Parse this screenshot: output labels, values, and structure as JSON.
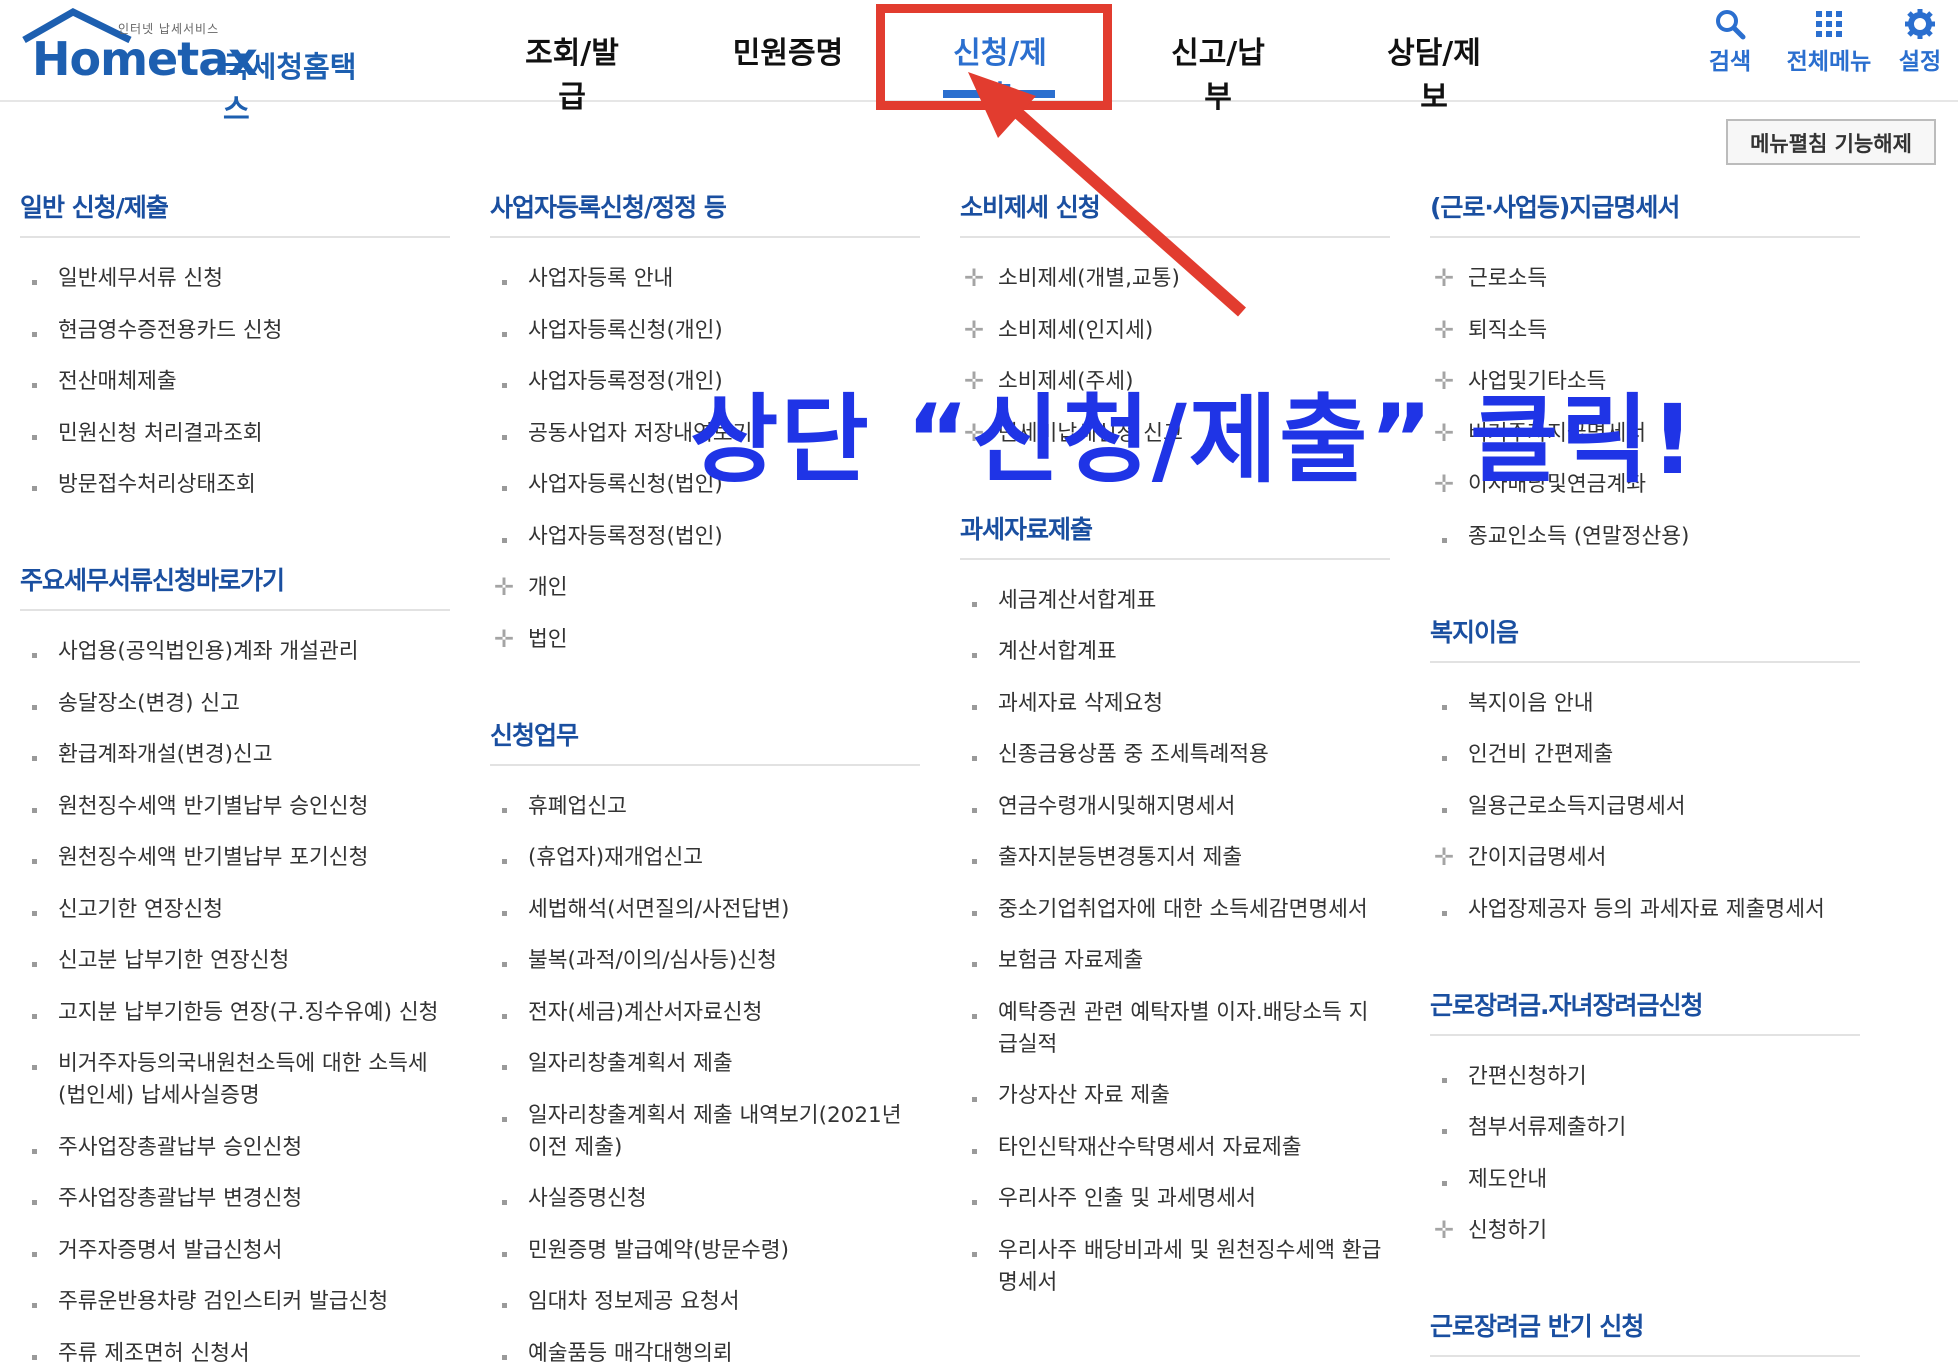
{
  "header": {
    "logo": {
      "small": "인터넷 납세서비스",
      "main": "Hometax",
      "sub": "국세청홈택스"
    },
    "nav": [
      {
        "label": "조회/발급"
      },
      {
        "label": "민원증명"
      },
      {
        "label": "신청/제출",
        "active": true
      },
      {
        "label": "신고/납부"
      },
      {
        "label": "상담/제보"
      }
    ],
    "utils": {
      "search": "검색",
      "all_menu": "전체메뉴",
      "settings": "설정"
    },
    "release_button": "메뉴펼침 기능해제"
  },
  "columns": [
    {
      "sections": [
        {
          "title": "일반 신청/제출",
          "items": [
            {
              "label": "일반세무서류 신청",
              "mark": "bullet"
            },
            {
              "label": "현금영수증전용카드 신청",
              "mark": "bullet"
            },
            {
              "label": "전산매체제출",
              "mark": "bullet"
            },
            {
              "label": "민원신청 처리결과조회",
              "mark": "bullet"
            },
            {
              "label": "방문접수처리상태조회",
              "mark": "bullet"
            }
          ]
        },
        {
          "title": "주요세무서류신청바로가기",
          "items": [
            {
              "label": "사업용(공익법인용)계좌 개설관리",
              "mark": "bullet"
            },
            {
              "label": "송달장소(변경) 신고",
              "mark": "bullet"
            },
            {
              "label": "환급계좌개설(변경)신고",
              "mark": "bullet"
            },
            {
              "label": "원천징수세액 반기별납부 승인신청",
              "mark": "bullet"
            },
            {
              "label": "원천징수세액 반기별납부 포기신청",
              "mark": "bullet"
            },
            {
              "label": "신고기한 연장신청",
              "mark": "bullet"
            },
            {
              "label": "신고분 납부기한 연장신청",
              "mark": "bullet"
            },
            {
              "label": "고지분 납부기한등 연장(구.징수유예) 신청",
              "mark": "bullet"
            },
            {
              "label": "비거주자등의국내원천소득에 대한 소득세(법인세) 납세사실증명",
              "mark": "bullet"
            },
            {
              "label": "주사업장총괄납부 승인신청",
              "mark": "bullet"
            },
            {
              "label": "주사업장총괄납부 변경신청",
              "mark": "bullet"
            },
            {
              "label": "거주자증명서 발급신청서",
              "mark": "bullet"
            },
            {
              "label": "주류운반용차량 검인스티커 발급신청",
              "mark": "bullet"
            },
            {
              "label": "주류 제조면허 신청서",
              "mark": "bullet"
            }
          ]
        }
      ]
    },
    {
      "sections": [
        {
          "title": "사업자등록신청/정정 등",
          "items": [
            {
              "label": "사업자등록 안내",
              "mark": "bullet"
            },
            {
              "label": "사업자등록신청(개인)",
              "mark": "bullet"
            },
            {
              "label": "사업자등록정정(개인)",
              "mark": "bullet"
            },
            {
              "label": "공동사업자 저장내역보기",
              "mark": "bullet"
            },
            {
              "label": "사업자등록신청(법인)",
              "mark": "bullet"
            },
            {
              "label": "사업자등록정정(법인)",
              "mark": "bullet"
            },
            {
              "label": "개인",
              "mark": "plus"
            },
            {
              "label": "법인",
              "mark": "plus"
            }
          ]
        },
        {
          "title": "신청업무",
          "items": [
            {
              "label": "휴폐업신고",
              "mark": "bullet"
            },
            {
              "label": "(휴업자)재개업신고",
              "mark": "bullet"
            },
            {
              "label": "세법해석(서면질의/사전답변)",
              "mark": "bullet"
            },
            {
              "label": "불복(과적/이의/심사등)신청",
              "mark": "bullet"
            },
            {
              "label": "전자(세금)계산서자료신청",
              "mark": "bullet"
            },
            {
              "label": "일자리창출계획서 제출",
              "mark": "bullet"
            },
            {
              "label": "일자리창출계획서 제출 내역보기(2021년 이전 제출)",
              "mark": "bullet"
            },
            {
              "label": "사실증명신청",
              "mark": "bullet"
            },
            {
              "label": "민원증명 발급예약(방문수령)",
              "mark": "bullet"
            },
            {
              "label": "임대차 정보제공 요청서",
              "mark": "bullet"
            },
            {
              "label": "예술품등 매각대행의뢰",
              "mark": "bullet"
            }
          ]
        }
      ]
    },
    {
      "sections": [
        {
          "title": "소비제세 신청",
          "items": [
            {
              "label": "소비제세(개별,교통)",
              "mark": "plus"
            },
            {
              "label": "소비제세(인지세)",
              "mark": "plus"
            },
            {
              "label": "소비제세(주세)",
              "mark": "plus"
            },
            {
              "label": "면세미납세신청 신고",
              "mark": "plus"
            }
          ]
        },
        {
          "title": "과세자료제출",
          "items": [
            {
              "label": "세금계산서합계표",
              "mark": "bullet"
            },
            {
              "label": "계산서합계표",
              "mark": "bullet"
            },
            {
              "label": "과세자료 삭제요청",
              "mark": "bullet"
            },
            {
              "label": "신종금융상품 중 조세특례적용",
              "mark": "bullet"
            },
            {
              "label": "연금수령개시및해지명세서",
              "mark": "bullet"
            },
            {
              "label": "출자지분등변경통지서 제출",
              "mark": "bullet"
            },
            {
              "label": "중소기업취업자에 대한 소득세감면명세서",
              "mark": "bullet"
            },
            {
              "label": "보험금 자료제출",
              "mark": "bullet"
            },
            {
              "label": "예탁증권 관련 예탁자별 이자.배당소득 지급실적",
              "mark": "bullet"
            },
            {
              "label": "가상자산 자료 제출",
              "mark": "bullet"
            },
            {
              "label": "타인신탁재산수탁명세서 자료제출",
              "mark": "bullet"
            },
            {
              "label": "우리사주 인출 및 과세명세서",
              "mark": "bullet"
            },
            {
              "label": "우리사주 배당비과세 및 원천징수세액 환급명세서",
              "mark": "bullet"
            }
          ]
        }
      ]
    },
    {
      "sections": [
        {
          "title": "(근로·사업등)지급명세서",
          "items": [
            {
              "label": "근로소득",
              "mark": "plus"
            },
            {
              "label": "퇴직소득",
              "mark": "plus"
            },
            {
              "label": "사업및기타소득",
              "mark": "plus"
            },
            {
              "label": "비거주자지급명세서",
              "mark": "plus"
            },
            {
              "label": "이자배당및연금계좌",
              "mark": "plus"
            },
            {
              "label": "종교인소득 (연말정산용)",
              "mark": "bullet"
            }
          ]
        },
        {
          "title": "복지이음",
          "items": [
            {
              "label": "복지이음 안내",
              "mark": "bullet"
            },
            {
              "label": "인건비 간편제출",
              "mark": "bullet"
            },
            {
              "label": "일용근로소득지급명세서",
              "mark": "bullet"
            },
            {
              "label": "간이지급명세서",
              "mark": "plus"
            },
            {
              "label": "사업장제공자 등의 과세자료 제출명세서",
              "mark": "bullet"
            }
          ]
        },
        {
          "title": "근로장려금.자녀장려금신청",
          "items": [
            {
              "label": "간편신청하기",
              "mark": "bullet"
            },
            {
              "label": "첨부서류제출하기",
              "mark": "bullet"
            },
            {
              "label": "제도안내",
              "mark": "bullet"
            },
            {
              "label": "신청하기",
              "mark": "plus"
            }
          ]
        },
        {
          "title": "근로장려금 반기 신청",
          "items": []
        }
      ]
    }
  ],
  "overlay": {
    "text": "상단 “신청/제출” 클릭!"
  },
  "colors": {
    "accent": "#2b6fcf",
    "section_title": "#1a4fa0",
    "annotation_red": "#e23c2f",
    "annotation_blue": "#1f34e6"
  }
}
